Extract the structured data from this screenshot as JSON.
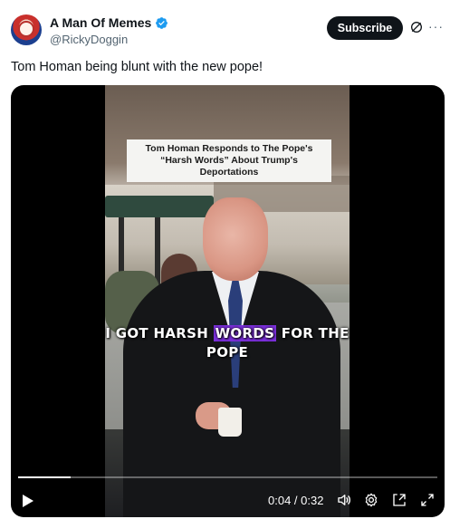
{
  "author": {
    "display_name": "A Man Of Memes",
    "handle": "@RickyDoggin",
    "verified": true
  },
  "actions": {
    "subscribe_label": "Subscribe"
  },
  "tweet": {
    "text": "Tom Homan being blunt with the new pope!"
  },
  "video": {
    "caption_title": "Tom Homan Responds to The Pope's “Harsh Words” About Trump's Deportations",
    "subtitle_before": "I GOT HARSH ",
    "subtitle_highlight": "WORDS",
    "subtitle_after": " FOR THE",
    "subtitle_line2": "POPE",
    "highlight_color": "#7b2fdb",
    "time_readout": "0:04 / 0:32",
    "progress_fraction": 0.125
  },
  "colors": {
    "verified_badge": "#1d9bf0",
    "subscribe_bg": "#0f1419"
  }
}
